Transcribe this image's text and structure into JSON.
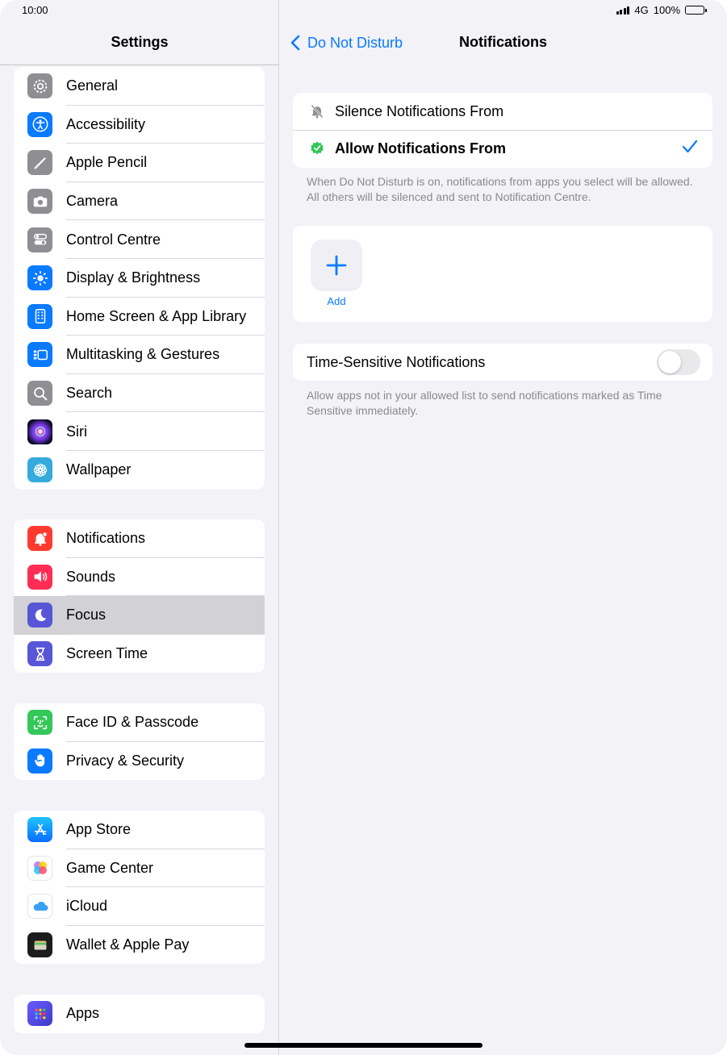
{
  "status": {
    "time": "10:00",
    "network": "4G",
    "battery": "100%"
  },
  "sidebar": {
    "title": "Settings",
    "groups": [
      {
        "items": [
          {
            "label": "General",
            "icon": "gear-icon",
            "color": "#8e8e93"
          },
          {
            "label": "Accessibility",
            "icon": "accessibility-icon",
            "color": "#0a7aff"
          },
          {
            "label": "Apple Pencil",
            "icon": "pencil-icon",
            "color": "#8e8e93"
          },
          {
            "label": "Camera",
            "icon": "camera-icon",
            "color": "#8e8e93"
          },
          {
            "label": "Control Centre",
            "icon": "toggles-icon",
            "color": "#8e8e93"
          },
          {
            "label": "Display & Brightness",
            "icon": "sun-icon",
            "color": "#0a7aff"
          },
          {
            "label": "Home Screen & App Library",
            "icon": "home-screen-icon",
            "color": "#0a7aff"
          },
          {
            "label": "Multitasking & Gestures",
            "icon": "multitasking-icon",
            "color": "#0a7aff"
          },
          {
            "label": "Search",
            "icon": "magnifier-icon",
            "color": "#8e8e93"
          },
          {
            "label": "Siri",
            "icon": "siri-icon",
            "color": "#1c1c3a"
          },
          {
            "label": "Wallpaper",
            "icon": "flower-icon",
            "color": "#35aadc"
          }
        ]
      },
      {
        "items": [
          {
            "label": "Notifications",
            "icon": "bell-icon",
            "color": "#ff3b30"
          },
          {
            "label": "Sounds",
            "icon": "speaker-icon",
            "color": "#ff2d55"
          },
          {
            "label": "Focus",
            "icon": "moon-icon",
            "color": "#5856d6",
            "selected": true
          },
          {
            "label": "Screen Time",
            "icon": "hourglass-icon",
            "color": "#5856d6"
          }
        ]
      },
      {
        "items": [
          {
            "label": "Face ID & Passcode",
            "icon": "face-id-icon",
            "color": "#34c759"
          },
          {
            "label": "Privacy & Security",
            "icon": "hand-icon",
            "color": "#0a7aff"
          }
        ]
      },
      {
        "items": [
          {
            "label": "App Store",
            "icon": "app-store-icon",
            "color": "#0a84ff"
          },
          {
            "label": "Game Center",
            "icon": "game-center-icon",
            "color": "#ffffff"
          },
          {
            "label": "iCloud",
            "icon": "cloud-icon",
            "color": "#ffffff"
          },
          {
            "label": "Wallet & Apple Pay",
            "icon": "wallet-icon",
            "color": "#1c1c1e"
          }
        ]
      },
      {
        "items": [
          {
            "label": "Apps",
            "icon": "apps-grid-icon",
            "color": "#5856d6"
          }
        ]
      }
    ]
  },
  "main": {
    "back_label": "Do Not Disturb",
    "title": "Notifications",
    "options": {
      "silence_label": "Silence Notifications From",
      "allow_label": "Allow Notifications From"
    },
    "options_footnote": "When Do Not Disturb is on, notifications from apps you select will be allowed. All others will be silenced and sent to Notification Centre.",
    "add_label": "Add",
    "time_sensitive_label": "Time-Sensitive Notifications",
    "time_sensitive_on": false,
    "time_sensitive_footnote": "Allow apps not in your allowed list to send notifications marked as Time Sensitive immediately."
  },
  "colors": {
    "accent": "#0a7aff",
    "check_green": "#34c759"
  }
}
